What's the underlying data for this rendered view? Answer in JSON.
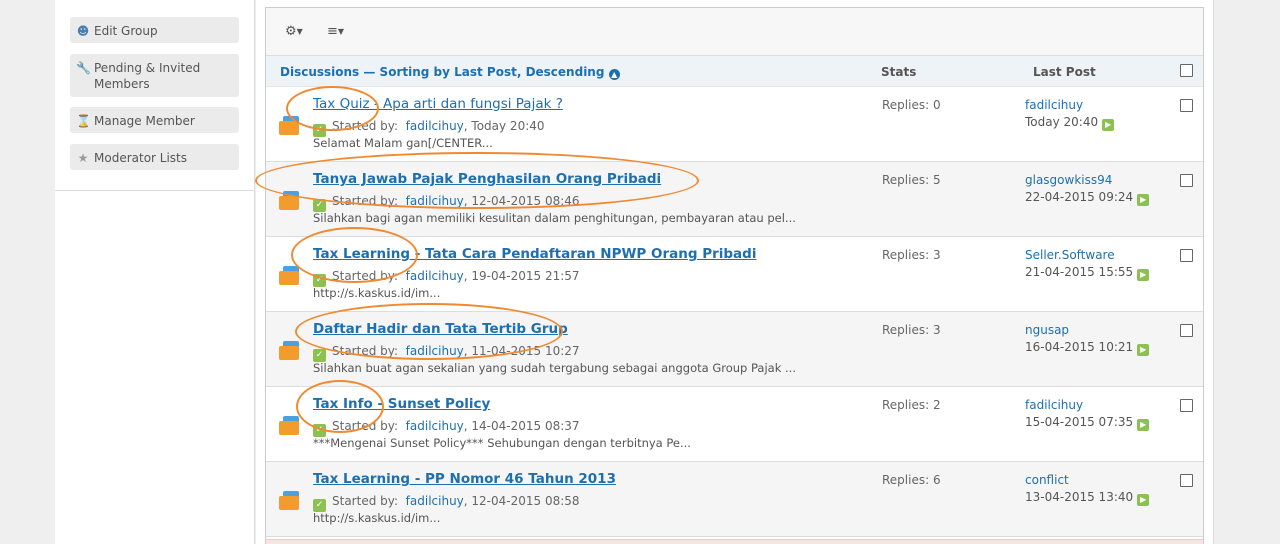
{
  "sidebar": {
    "items": [
      {
        "label": "Edit Group",
        "icon": "group-edit-icon"
      },
      {
        "label": "Pending & Invited Members",
        "icon": "wrench-icon"
      },
      {
        "label": "Manage Member",
        "icon": "hourglass-icon"
      },
      {
        "label": "Moderator Lists",
        "icon": "star-icon"
      }
    ]
  },
  "toolbar": {
    "settings_icon": "gear-icon",
    "filter_icon": "sliders-icon"
  },
  "table_header": {
    "discussions": "Discussions — Sorting by Last Post, Descending",
    "stats": "Stats",
    "last_post": "Last Post"
  },
  "threads": [
    {
      "title": "Tax Quiz - Apa arti dan fungsi Pajak ?",
      "bold": false,
      "started_label": "Started by:",
      "author": "fadilcihuy",
      "date": ", Today 20:40",
      "snippet": "Selamat Malam gan[/CENTER...",
      "replies": "Replies: 0",
      "last_user": "fadilcihuy",
      "last_date": "Today 20:40"
    },
    {
      "title": "Tanya Jawab Pajak Penghasilan Orang Pribadi",
      "bold": true,
      "started_label": "Started by:",
      "author": "fadilcihuy",
      "date": ", 12-04-2015 08:46",
      "snippet": "Silahkan bagi agan memiliki kesulitan dalam penghitungan, pembayaran atau pel...",
      "replies": "Replies: 5",
      "last_user": "glasgowkiss94",
      "last_date": "22-04-2015 09:24"
    },
    {
      "title": "Tax Learning - Tata Cara Pendaftaran NPWP Orang Pribadi",
      "bold": true,
      "started_label": "Started by:",
      "author": "fadilcihuy",
      "date": ", 19-04-2015 21:57",
      "snippet": "http://s.kaskus.id/im...",
      "replies": "Replies: 3",
      "last_user": "Seller.Software",
      "last_date": "21-04-2015 15:55"
    },
    {
      "title": "Daftar Hadir dan Tata Tertib Grup",
      "bold": true,
      "started_label": "Started by:",
      "author": "fadilcihuy",
      "date": ", 11-04-2015 10:27",
      "snippet": "Silahkan buat agan sekalian yang sudah tergabung sebagai anggota Group Pajak ...",
      "replies": "Replies: 3",
      "last_user": "ngusap",
      "last_date": "16-04-2015 10:21"
    },
    {
      "title": "Tax Info - Sunset Policy",
      "bold": true,
      "started_label": "Started by:",
      "author": "fadilcihuy",
      "date": ", 14-04-2015 08:37",
      "snippet": "***Mengenai Sunset Policy*** Sehubungan dengan terbitnya Pe...",
      "replies": "Replies: 2",
      "last_user": "fadilcihuy",
      "last_date": "15-04-2015 07:35"
    },
    {
      "title": "Tax Learning - PP Nomor 46 Tahun 2013",
      "bold": true,
      "started_label": "Started by:",
      "author": "fadilcihuy",
      "date": ", 12-04-2015 08:58",
      "snippet": "http://s.kaskus.id/im...",
      "replies": "Replies: 6",
      "last_user": "conflict",
      "last_date": "13-04-2015 13:40"
    }
  ],
  "colors": {
    "link": "#1e6fb0",
    "annotation": "#f08a32",
    "accent_green": "#8cc152"
  }
}
